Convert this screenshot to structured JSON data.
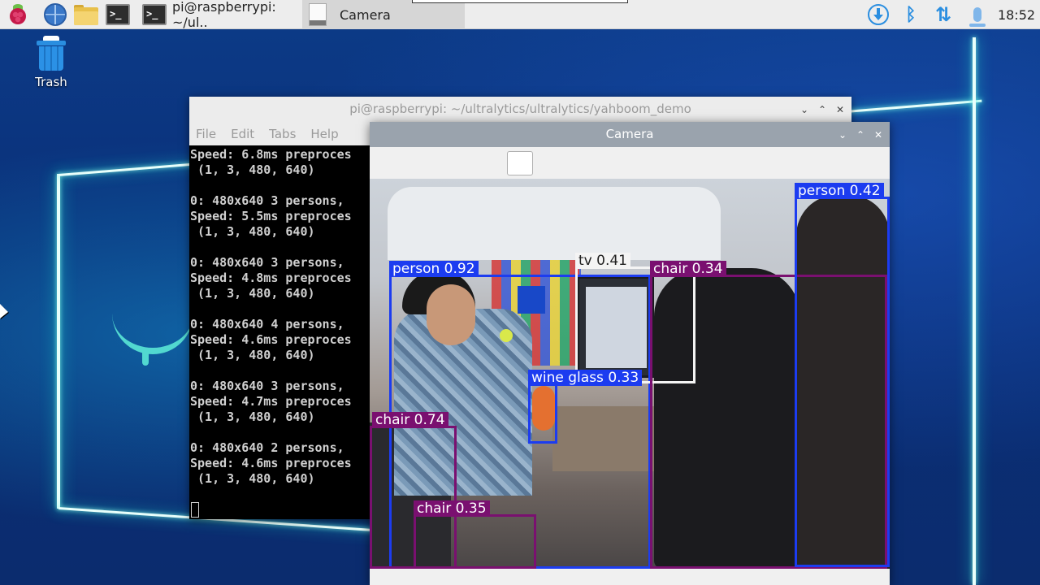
{
  "taskbar": {
    "terminal_task_label": "pi@raspberrypi: ~/ul..",
    "camera_task_label": "Camera",
    "clock": "18:52",
    "terminal_glyph": ">_",
    "bluetooth_glyph": "ᛒ",
    "network_glyph": "⇅"
  },
  "desktop": {
    "trash_label": "Trash"
  },
  "window_controls": {
    "minimize": "⌄",
    "maximize": "⌃",
    "close": "✕"
  },
  "terminal": {
    "title": "pi@raspberrypi: ~/ultralytics/ultralytics/yahboom_demo",
    "menu": [
      "File",
      "Edit",
      "Tabs",
      "Help"
    ],
    "lines": [
      "Speed: 6.8ms preproces",
      " (1, 3, 480, 640)",
      "",
      "0: 480x640 3 persons,",
      "Speed: 5.5ms preproces",
      " (1, 3, 480, 640)",
      "",
      "0: 480x640 3 persons,",
      "Speed: 4.8ms preproces",
      " (1, 3, 480, 640)",
      "",
      "0: 480x640 4 persons,",
      "Speed: 4.6ms preproces",
      " (1, 3, 480, 640)",
      "",
      "0: 480x640 3 persons,",
      "Speed: 4.7ms preproces",
      " (1, 3, 480, 640)",
      "",
      "0: 480x640 2 persons,",
      "Speed: 4.6ms preproces",
      " (1, 3, 480, 640)"
    ]
  },
  "camera": {
    "title": "Camera",
    "detections": [
      {
        "label": "person 0.92",
        "color": "#1c3cf0"
      },
      {
        "label": "tv 0.41",
        "color": "#f4f4f4"
      },
      {
        "label": "chair 0.34",
        "color": "#7a1070"
      },
      {
        "label": "person 0.42",
        "color": "#1c3cf0"
      },
      {
        "label": "wine glass 0.33",
        "color": "#1c3cf0"
      },
      {
        "label": "chair 0.74",
        "color": "#7a1070"
      },
      {
        "label": "chair 0.35",
        "color": "#7a1070"
      }
    ]
  },
  "colors": {
    "person": "#1c3cf0",
    "chair": "#7a1070",
    "tv": "#f4f4f4"
  }
}
